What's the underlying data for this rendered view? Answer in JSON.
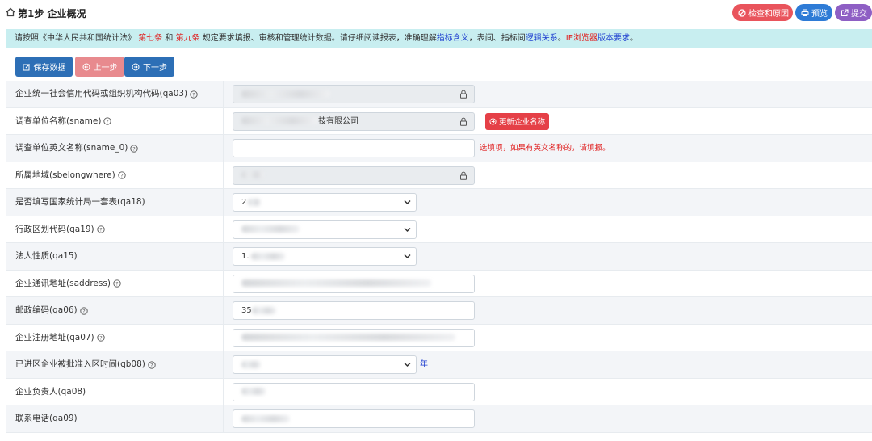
{
  "header": {
    "title": "第1步 企业概况",
    "buttons": {
      "check": "检查和原因",
      "preview": "预览",
      "submit": "提交"
    }
  },
  "notice": {
    "prefix": "请按照《中华人民共和国统计法》",
    "art7": "第七条",
    "and": "和",
    "art9": "第九条",
    "middle": "规定要求填报、审核和管理统计数据。请仔细阅读报表，准确理解",
    "link1": "指标含义",
    "sep": "，表间、指标间",
    "link2": "逻辑关系",
    "dot": "。",
    "browser": "IE浏览器",
    "link3": "版本要求",
    "end": "。"
  },
  "toolbar": {
    "save": "保存数据",
    "prev": "上一步",
    "next": "下一步"
  },
  "form": {
    "rows": [
      {
        "label": "企业统一社会信用代码或组织机构代码(qa03)",
        "value": "",
        "type": "readonly"
      },
      {
        "label": "调查单位名称(sname)",
        "value": "技有限公司",
        "type": "readonly",
        "action": "更新企业名称"
      },
      {
        "label": "调查单位英文名称(sname_0)",
        "value": "",
        "type": "text",
        "hint": "选填项，如果有英文名称的，请填报。"
      },
      {
        "label": "所属地域(sbelongwhere)",
        "value": "",
        "type": "readonly"
      },
      {
        "label": "是否填写国家统计局一套表(qa18)",
        "value": "2",
        "type": "select"
      },
      {
        "label": "行政区划代码(qa19)",
        "value": "",
        "type": "select"
      },
      {
        "label": "法人性质(qa15)",
        "value": "1.",
        "type": "select"
      },
      {
        "label": "企业通讯地址(saddress)",
        "value": "",
        "type": "text"
      },
      {
        "label": "邮政编码(qa06)",
        "value": "35",
        "type": "text"
      },
      {
        "label": "企业注册地址(qa07)",
        "value": "",
        "type": "text"
      },
      {
        "label": "已进区企业被批准入区时间(qb08)",
        "value": "",
        "type": "select",
        "suffix": "年"
      },
      {
        "label": "企业负责人(qa08)",
        "value": "",
        "type": "text"
      },
      {
        "label": "联系电话(qa09)",
        "value": "",
        "type": "text"
      }
    ]
  }
}
